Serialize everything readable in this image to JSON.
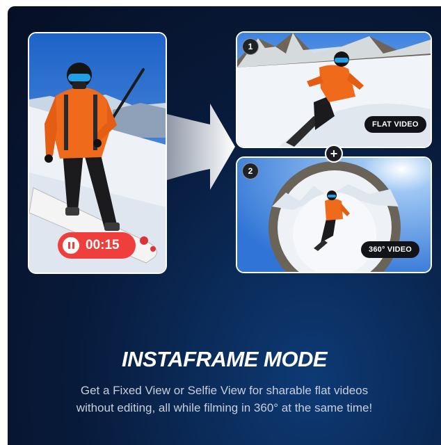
{
  "cards": {
    "left": {
      "timer": "00:15"
    },
    "flat": {
      "number": "1",
      "label": "FLAT VIDEO"
    },
    "sphere": {
      "number": "2",
      "label": "360° VIDEO"
    }
  },
  "plus_symbol": "+",
  "heading": "INSTAFRAME MODE",
  "description": {
    "line1": "Get a Fixed View or Selfie View for sharable flat videos",
    "line2": "without editing, all while filming in 360° at the same time!"
  },
  "colors": {
    "background": "#081a3a",
    "record_red": "#ee3f3c",
    "jacket_orange": "#f06a1c",
    "pill_dark": "#111318"
  }
}
